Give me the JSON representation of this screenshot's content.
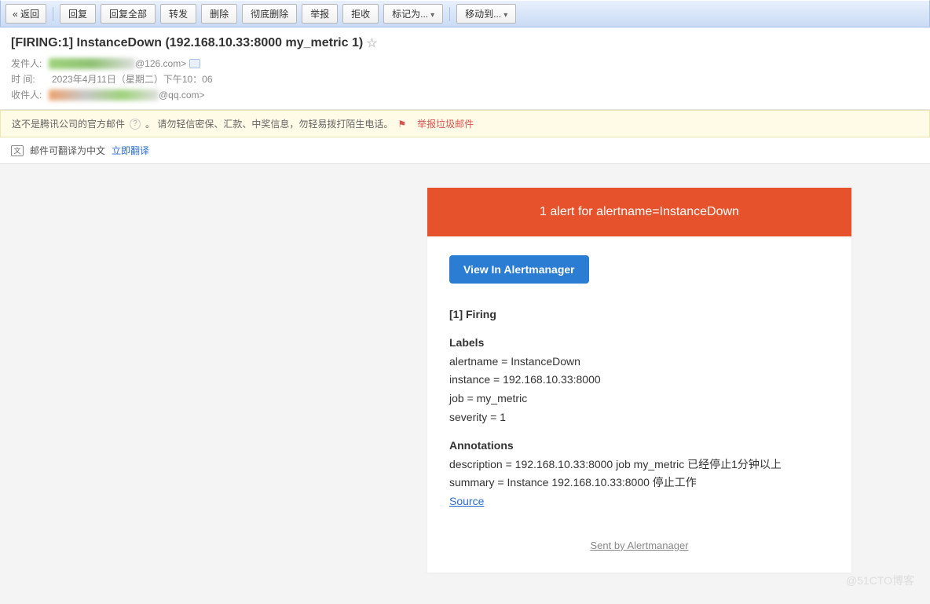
{
  "toolbar": {
    "back": "« 返回",
    "reply": "回复",
    "reply_all": "回复全部",
    "forward": "转发",
    "delete": "删除",
    "delete_perm": "彻底删除",
    "report": "举报",
    "reject": "拒收",
    "mark_as": "标记为...",
    "move_to": "移动到..."
  },
  "subject": "[FIRING:1] InstanceDown (192.168.10.33:8000 my_metric 1)",
  "meta": {
    "from_label": "发件人:",
    "from_suffix": "@126.com>",
    "time_label": "时    间:",
    "time_value": "2023年4月11日（星期二）下午10：06",
    "to_label": "收件人:",
    "to_suffix": "@qq.com>"
  },
  "warning": {
    "text1": "这不是腾讯公司的官方邮件",
    "text2": "。 请勿轻信密保、汇款、中奖信息，勿轻易拨打陌生电话。",
    "report": "举报垃圾邮件"
  },
  "translate": {
    "text": "邮件可翻译为中文",
    "link": "立即翻译"
  },
  "alert": {
    "header": "1 alert for alertname=InstanceDown",
    "view_btn": "View In Alertmanager",
    "firing": "[1] Firing",
    "labels_title": "Labels",
    "labels": {
      "alertname": "alertname = InstanceDown",
      "instance": "instance = 192.168.10.33:8000",
      "job": "job = my_metric",
      "severity": "severity = 1"
    },
    "annotations_title": "Annotations",
    "annotations": {
      "description": "description = 192.168.10.33:8000 job my_metric 已经停止1分钟以上",
      "summary": "summary = Instance 192.168.10.33:8000 停止工作"
    },
    "source": "Source",
    "footer": "Sent by Alertmanager"
  },
  "watermark": "@51CTO博客"
}
